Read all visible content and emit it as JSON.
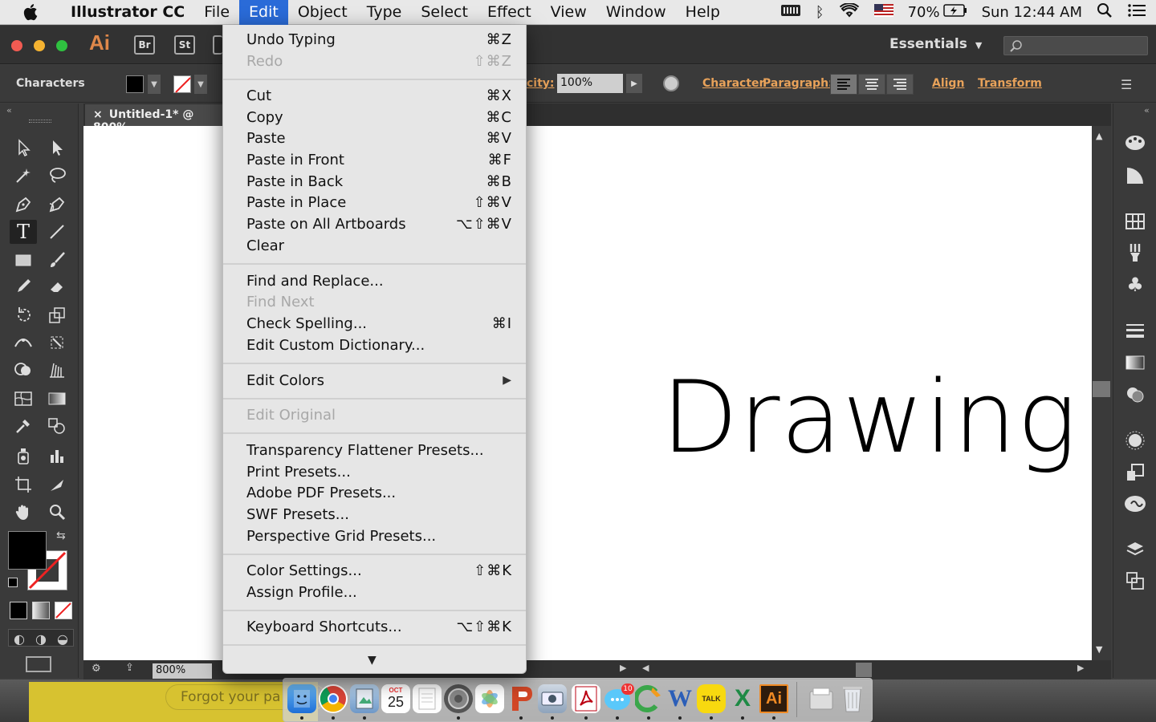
{
  "menubar": {
    "app_name": "Illustrator CC",
    "menus": [
      "File",
      "Edit",
      "Object",
      "Type",
      "Select",
      "Effect",
      "View",
      "Window",
      "Help"
    ],
    "battery": "70%",
    "clock": "Sun 12:44 AM"
  },
  "appbar": {
    "logo": "Ai",
    "bridge_label": "Br",
    "stock_label": "St",
    "workspace": "Essentials"
  },
  "control_bar": {
    "selection_label": "Characters",
    "opacity_value": "100%",
    "opacity_label_fragment": "city:",
    "links": [
      "Character",
      "Paragraph:",
      "Align",
      "Transform"
    ]
  },
  "document": {
    "tab_title": "Untitled-1* @ 800%",
    "canvas_text": "Drawing",
    "zoom": "800%"
  },
  "edit_menu": {
    "groups": [
      [
        {
          "label": "Undo Typing",
          "shortcut": "⌘Z",
          "disabled": false
        },
        {
          "label": "Redo",
          "shortcut": "⇧⌘Z",
          "disabled": true
        }
      ],
      [
        {
          "label": "Cut",
          "shortcut": "⌘X",
          "disabled": false
        },
        {
          "label": "Copy",
          "shortcut": "⌘C",
          "disabled": false
        },
        {
          "label": "Paste",
          "shortcut": "⌘V",
          "disabled": false
        },
        {
          "label": "Paste in Front",
          "shortcut": "⌘F",
          "disabled": false
        },
        {
          "label": "Paste in Back",
          "shortcut": "⌘B",
          "disabled": false
        },
        {
          "label": "Paste in Place",
          "shortcut": "⇧⌘V",
          "disabled": false
        },
        {
          "label": "Paste on All Artboards",
          "shortcut": "⌥⇧⌘V",
          "disabled": false
        },
        {
          "label": "Clear",
          "shortcut": "",
          "disabled": false
        }
      ],
      [
        {
          "label": "Find and Replace...",
          "shortcut": "",
          "disabled": false
        },
        {
          "label": "Find Next",
          "shortcut": "",
          "disabled": true
        },
        {
          "label": "Check Spelling...",
          "shortcut": "⌘I",
          "disabled": false
        },
        {
          "label": "Edit Custom Dictionary...",
          "shortcut": "",
          "disabled": false
        }
      ],
      [
        {
          "label": "Edit Colors",
          "shortcut": "▶",
          "disabled": false
        }
      ],
      [
        {
          "label": "Edit Original",
          "shortcut": "",
          "disabled": true
        }
      ],
      [
        {
          "label": "Transparency Flattener Presets...",
          "shortcut": "",
          "disabled": false
        },
        {
          "label": "Print Presets...",
          "shortcut": "",
          "disabled": false
        },
        {
          "label": "Adobe PDF Presets...",
          "shortcut": "",
          "disabled": false
        },
        {
          "label": "SWF Presets...",
          "shortcut": "",
          "disabled": false
        },
        {
          "label": "Perspective Grid Presets...",
          "shortcut": "",
          "disabled": false
        }
      ],
      [
        {
          "label": "Color Settings...",
          "shortcut": "⇧⌘K",
          "disabled": false
        },
        {
          "label": "Assign Profile...",
          "shortcut": "",
          "disabled": false
        }
      ],
      [
        {
          "label": "Keyboard Shortcuts...",
          "shortcut": "⌥⇧⌘K",
          "disabled": false
        }
      ]
    ],
    "more_indicator": "▼"
  },
  "bottom": {
    "forgot_text": "Forgot your pa",
    "calendar_day": "25",
    "calendar_month": "OCT",
    "messages_badge": "10",
    "word_label": "W",
    "kakao_label": "TALK",
    "excel_label": "X",
    "ai_label": "Ai"
  },
  "colors": {
    "menu_highlight": "#2a6bd8",
    "ai_orange": "#e0884a",
    "link_orange": "#e8a25a",
    "panel_dark": "#3a3a3a"
  }
}
